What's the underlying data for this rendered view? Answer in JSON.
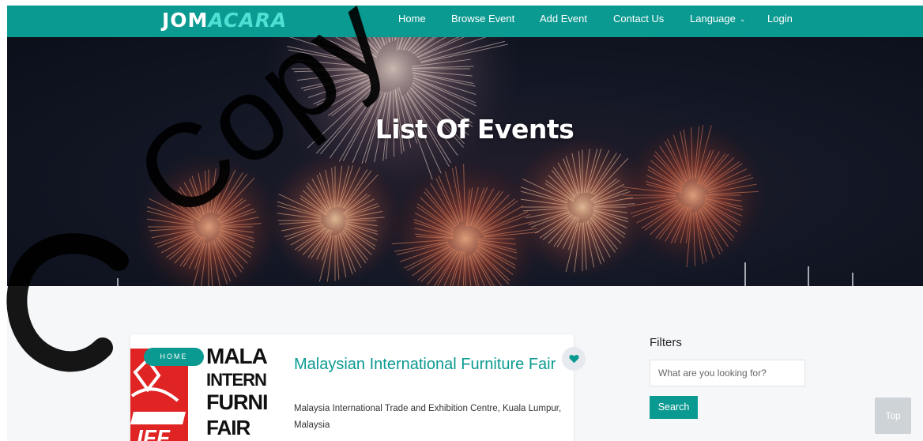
{
  "brand": {
    "logo_part1": "JOM",
    "logo_part2": "ACARA",
    "color": "#0b9a91"
  },
  "nav": {
    "items": [
      {
        "label": "Home"
      },
      {
        "label": "Browse Event"
      },
      {
        "label": "Add Event"
      },
      {
        "label": "Contact Us"
      },
      {
        "label": "Language",
        "icon": "chevron-down-icon"
      },
      {
        "label": "Login"
      }
    ]
  },
  "hero": {
    "title": "List Of Events"
  },
  "event": {
    "badge": "HOME",
    "title": "Malaysian International Furniture Fair",
    "location": "Malaysia International Trade and Exhibition Centre, Kuala Lumpur, Malaysia",
    "thumbnail_text": [
      "MALA",
      "INTERN",
      "FURNI",
      "FAIR"
    ],
    "thumbnail_mark": "IFF",
    "favorite_icon": "heart-icon"
  },
  "filters": {
    "title": "Filters",
    "search_placeholder": "What are you looking for?",
    "search_button": "Search"
  },
  "scroll_top": {
    "label": "Top"
  },
  "watermark": {
    "text": "Copy",
    "color": "#000000"
  }
}
